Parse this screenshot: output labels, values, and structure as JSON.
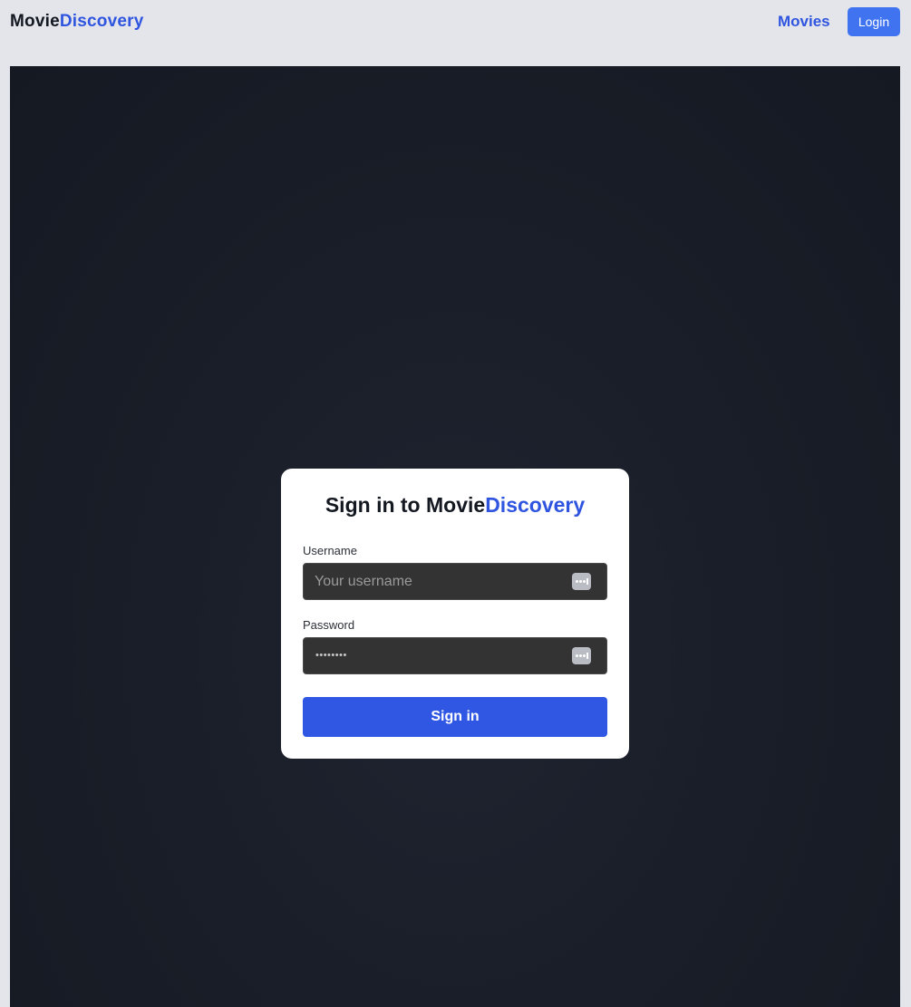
{
  "header": {
    "brand_part1": "Movie",
    "brand_part2": "Discovery",
    "nav_movies": "Movies",
    "login_label": "Login"
  },
  "login_form": {
    "title_prefix": "Sign in to Movie",
    "title_highlight": "Discovery",
    "username_label": "Username",
    "username_placeholder": "Your username",
    "username_value": "",
    "password_label": "Password",
    "password_masked": "••••••••",
    "submit_label": "Sign in",
    "autofill_icon": "key-autofill-icon"
  },
  "colors": {
    "accent": "#2f55e0",
    "login_button": "#3f73f0",
    "submit_button": "#2f57e3",
    "page_background": "#e3e5ea",
    "hero_background": "#1a1e28",
    "input_background": "#333333"
  }
}
